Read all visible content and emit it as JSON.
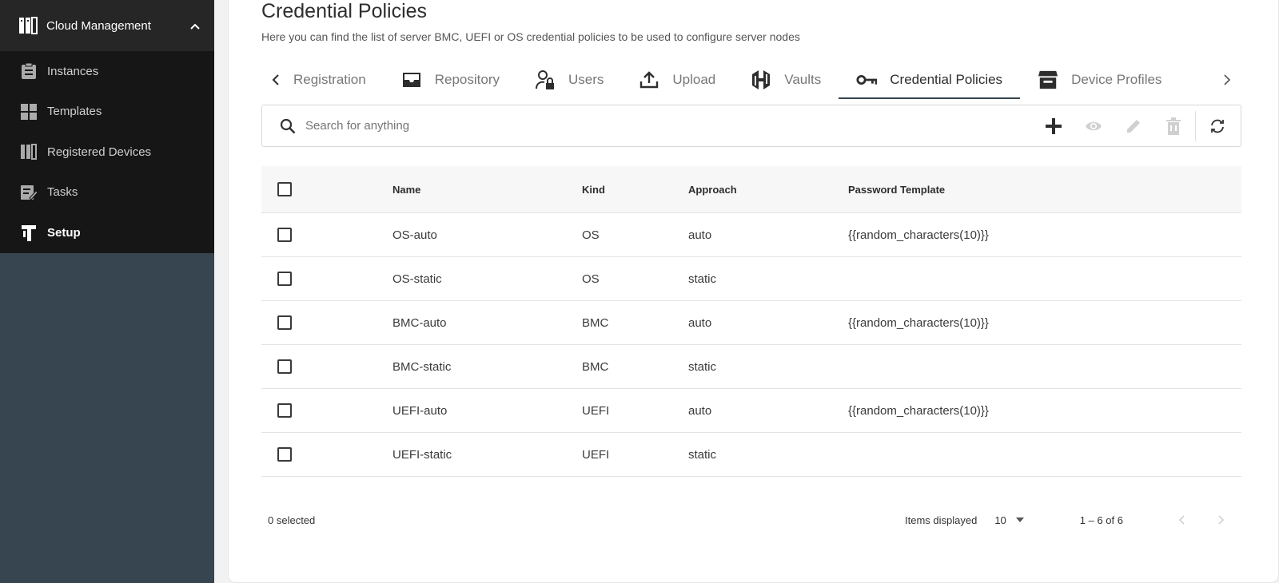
{
  "sidebar": {
    "header": {
      "label": "Cloud Management",
      "icon": "server-rack-icon"
    },
    "items": [
      {
        "label": "Instances",
        "icon": "clipboard-icon"
      },
      {
        "label": "Templates",
        "icon": "grid-icon"
      },
      {
        "label": "Registered Devices",
        "icon": "server-rack-icon"
      },
      {
        "label": "Tasks",
        "icon": "checklist-edit-icon"
      },
      {
        "label": "Setup",
        "icon": "setup-logo-icon",
        "active": true
      }
    ]
  },
  "page": {
    "title": "Credential Policies",
    "description": "Here you can find the list of server BMC, UEFI or OS credential policies to be used to configure server nodes"
  },
  "tabs": [
    {
      "label": "Registration",
      "icon": ""
    },
    {
      "label": "Repository",
      "icon": "archive-box-icon"
    },
    {
      "label": "Users",
      "icon": "user-lock-icon"
    },
    {
      "label": "Upload",
      "icon": "upload-icon"
    },
    {
      "label": "Vaults",
      "icon": "vault-logo-icon"
    },
    {
      "label": "Credential Policies",
      "icon": "key-icon",
      "active": true
    },
    {
      "label": "Device Profiles",
      "icon": "storefront-icon"
    }
  ],
  "search": {
    "placeholder": "Search for anything",
    "value": ""
  },
  "table": {
    "columns": [
      "Name",
      "Kind",
      "Approach",
      "Password Template"
    ],
    "rows": [
      {
        "name": "OS-auto",
        "kind": "OS",
        "approach": "auto",
        "password_template": "{{random_characters(10)}}"
      },
      {
        "name": "OS-static",
        "kind": "OS",
        "approach": "static",
        "password_template": ""
      },
      {
        "name": "BMC-auto",
        "kind": "BMC",
        "approach": "auto",
        "password_template": "{{random_characters(10)}}"
      },
      {
        "name": "BMC-static",
        "kind": "BMC",
        "approach": "static",
        "password_template": ""
      },
      {
        "name": "UEFI-auto",
        "kind": "UEFI",
        "approach": "auto",
        "password_template": "{{random_characters(10)}}"
      },
      {
        "name": "UEFI-static",
        "kind": "UEFI",
        "approach": "static",
        "password_template": ""
      }
    ]
  },
  "footer": {
    "selected": "0 selected",
    "items_label": "Items displayed",
    "per_page": "10",
    "range": "1 – 6 of 6"
  },
  "colors": {
    "sidebar_bg": "#36454f",
    "menu_bg": "#161616",
    "accent": "#36454f"
  }
}
